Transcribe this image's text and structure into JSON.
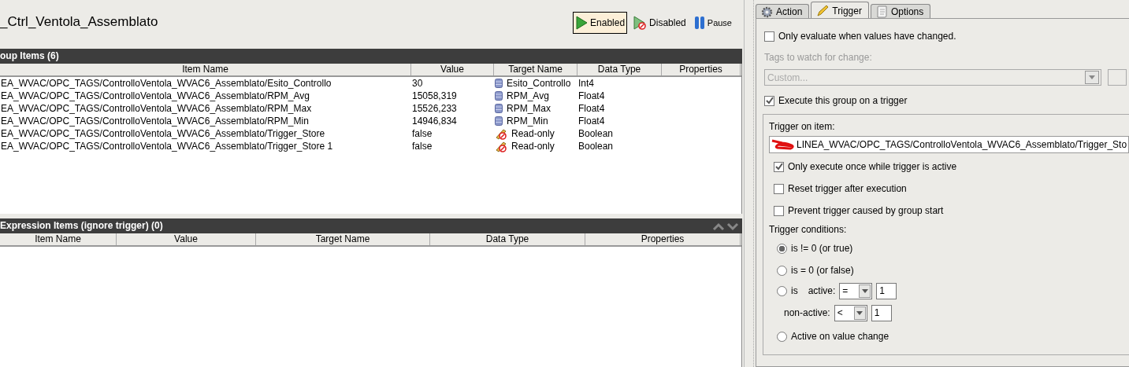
{
  "title": "_Ctrl_Ventola_Assemblato",
  "toolbar": [
    {
      "label": "Enabled",
      "kind": "enabled",
      "selected": true
    },
    {
      "label": "Disabled",
      "kind": "disabled",
      "selected": false
    },
    {
      "label": "Pause",
      "kind": "pause",
      "selected": false
    }
  ],
  "group_items": {
    "title": "oup Items (6)",
    "columns": [
      "Item Name",
      "Value",
      "Target Name",
      "Data Type",
      "Properties"
    ],
    "rows": [
      {
        "item_name": "EA_WVAC/OPC_TAGS/ControlloVentola_WVAC6_Assemblato/Esito_Controllo",
        "value": "30",
        "kind": "database",
        "target_name": "Esito_Controllo",
        "data_type": "Int4"
      },
      {
        "item_name": "EA_WVAC/OPC_TAGS/ControlloVentola_WVAC6_Assemblato/RPM_Avg",
        "value": "15058,319",
        "kind": "database",
        "target_name": "RPM_Avg",
        "data_type": "Float4"
      },
      {
        "item_name": "EA_WVAC/OPC_TAGS/ControlloVentola_WVAC6_Assemblato/RPM_Max",
        "value": "15526,233",
        "kind": "database",
        "target_name": "RPM_Max",
        "data_type": "Float4"
      },
      {
        "item_name": "EA_WVAC/OPC_TAGS/ControlloVentola_WVAC6_Assemblato/RPM_Min",
        "value": "14946,834",
        "kind": "database",
        "target_name": "RPM_Min",
        "data_type": "Float4"
      },
      {
        "item_name": "EA_WVAC/OPC_TAGS/ControlloVentola_WVAC6_Assemblato/Trigger_Store",
        "value": "false",
        "kind": "readonly",
        "target_name": "Read-only",
        "data_type": "Boolean"
      },
      {
        "item_name": "EA_WVAC/OPC_TAGS/ControlloVentola_WVAC6_Assemblato/Trigger_Store 1",
        "value": "false",
        "kind": "readonly",
        "target_name": "Read-only",
        "data_type": "Boolean"
      }
    ]
  },
  "expression_items": {
    "title": "Expression Items (ignore trigger) (0)",
    "columns": [
      "Item Name",
      "Value",
      "Target Name",
      "Data Type",
      "Properties"
    ]
  },
  "tabs": [
    {
      "label": "Action",
      "kind": "gear",
      "selected": false
    },
    {
      "label": "Trigger",
      "kind": "pencil",
      "selected": true
    },
    {
      "label": "Options",
      "kind": "page",
      "selected": false
    }
  ],
  "trigger_tab": {
    "only_evaluate": {
      "label": "Only evaluate when values have changed.",
      "checked": false
    },
    "tags_to_watch": {
      "label": "Tags to watch for change:",
      "value": "Custom...",
      "disabled": true
    },
    "execute_on_trigger": {
      "label": "Execute this group on a trigger",
      "checked": true
    },
    "trigger_on_item": {
      "label": "Trigger on item:",
      "value": "LINEA_WVAC/OPC_TAGS/ControlloVentola_WVAC6_Assemblato/Trigger_Sto"
    },
    "options": [
      {
        "label": "Only execute once while trigger is active",
        "checked": true
      },
      {
        "label": "Reset trigger after execution",
        "checked": false
      },
      {
        "label": "Prevent trigger caused by group start",
        "checked": false
      }
    ],
    "conditions_label": "Trigger conditions:",
    "conditions": [
      {
        "kind": "plain",
        "label": "is != 0 (or true)",
        "selected": true
      },
      {
        "kind": "plain",
        "label": "is = 0 (or false)",
        "selected": false
      },
      {
        "kind": "compare",
        "label": "is",
        "active_label": "active:",
        "active_op": "=",
        "active_value": "1",
        "nonactive_label": "non-active:",
        "nonactive_op": "<",
        "nonactive_value": "1",
        "selected": false
      },
      {
        "kind": "plain",
        "label": "Active on value change",
        "selected": false
      }
    ]
  }
}
